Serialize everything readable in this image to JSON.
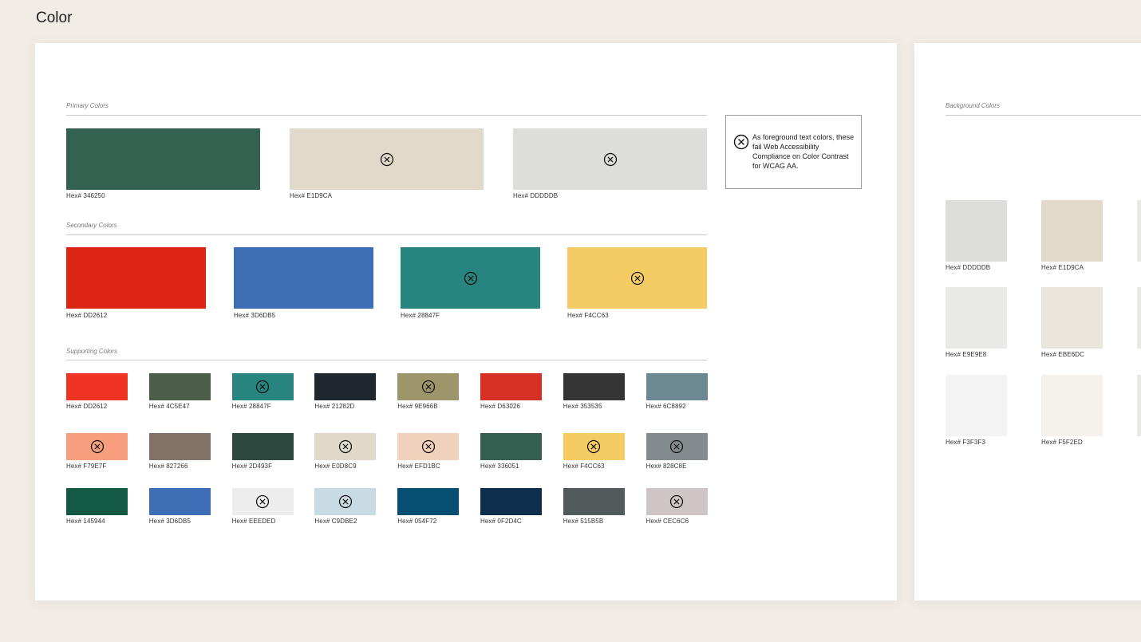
{
  "page": {
    "title": "Color"
  },
  "fail_note": "As foreground text colors, these fail Web Accessibility Compliance on Color Contrast for WCAG AA.",
  "sections": {
    "primary": {
      "label": "Primary Colors",
      "swatches": [
        {
          "color": "#346250",
          "hex": "Hex# 346250",
          "fail": false
        },
        {
          "color": "#E1D9CA",
          "hex": "Hex# E1D9CA",
          "fail": true
        },
        {
          "color": "#DDDDDB",
          "hex": "Hex# DDDDDB",
          "fail": true
        }
      ]
    },
    "secondary": {
      "label": "Secondary Colors",
      "swatches": [
        {
          "color": "#DD2612",
          "hex": "Hex# DD2612",
          "fail": false
        },
        {
          "color": "#3D6DB5",
          "hex": "Hex# 3D6DB5",
          "fail": false
        },
        {
          "color": "#28847F",
          "hex": "Hex# 28847F",
          "fail": true
        },
        {
          "color": "#F4CC63",
          "hex": "Hex# F4CC63",
          "fail": true
        }
      ]
    },
    "supporting": {
      "label": "Supporting Colors",
      "swatches": [
        {
          "color": "#EE3524",
          "hex": "Hex# DD2612",
          "fail": false
        },
        {
          "color": "#4C5E47",
          "hex": "Hex# 4C5E47",
          "fail": false
        },
        {
          "color": "#28847F",
          "hex": "Hex# 28847F",
          "fail": true
        },
        {
          "color": "#21282D",
          "hex": "Hex# 21282D",
          "fail": false
        },
        {
          "color": "#9E966B",
          "hex": "Hex# 9E966B",
          "fail": true
        },
        {
          "color": "#D63026",
          "hex": "Hex# D63026",
          "fail": false
        },
        {
          "color": "#353535",
          "hex": "Hex# 353535",
          "fail": false
        },
        {
          "color": "#6C8892",
          "hex": "Hex# 6C8892",
          "fail": false
        },
        {
          "color": "#F79E7F",
          "hex": "Hex# F79E7F",
          "fail": true
        },
        {
          "color": "#827266",
          "hex": "Hex# 827266",
          "fail": false
        },
        {
          "color": "#2D493F",
          "hex": "Hex# 2D493F",
          "fail": false
        },
        {
          "color": "#E0D8C9",
          "hex": "Hex# E0D8C9",
          "fail": true
        },
        {
          "color": "#EFD1BC",
          "hex": "Hex# EFD1BC",
          "fail": true
        },
        {
          "color": "#336051",
          "hex": "Hex# 336051",
          "fail": false
        },
        {
          "color": "#F4CC63",
          "hex": "Hex# F4CC63",
          "fail": true
        },
        {
          "color": "#828C8E",
          "hex": "Hex# 828C8E",
          "fail": true
        },
        {
          "color": "#145944",
          "hex": "Hex# 145944",
          "fail": false
        },
        {
          "color": "#3D6DB5",
          "hex": "Hex# 3D6DB5",
          "fail": false
        },
        {
          "color": "#EEEDED",
          "hex": "Hex# EEEDED",
          "fail": true
        },
        {
          "color": "#C9DBE2",
          "hex": "Hex# C9DBE2",
          "fail": true
        },
        {
          "color": "#054F72",
          "hex": "Hex# 054F72",
          "fail": false
        },
        {
          "color": "#0F2D4C",
          "hex": "Hex# 0F2D4C",
          "fail": false
        },
        {
          "color": "#515B5B",
          "hex": "Hex# 515B5B",
          "fail": false
        },
        {
          "color": "#CEC6C6",
          "hex": "Hex# CEC6C6",
          "fail": true
        }
      ]
    },
    "background": {
      "label": "Background Colors",
      "swatches": [
        {
          "color": "#DDDDDB",
          "hex": "Hex# DDDDDB",
          "fail": false
        },
        {
          "color": "#E1D9CA",
          "hex": "Hex# E1D9CA",
          "fail": false
        },
        {
          "color": "#E9E9E8",
          "hex": "Hex# E9E9E8",
          "fail": false
        },
        {
          "color": "#EBE6DC",
          "hex": "Hex# EBE6DC",
          "fail": false
        },
        {
          "color": "#F3F3F3",
          "hex": "Hex# F3F3F3",
          "fail": false
        },
        {
          "color": "#F5F2ED",
          "hex": "Hex# F5F2ED",
          "fail": false
        }
      ],
      "partial_column_color": "#E8E8E6"
    }
  }
}
